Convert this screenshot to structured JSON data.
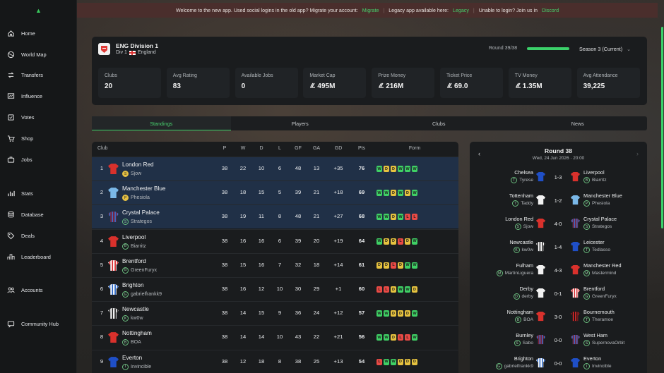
{
  "banner": {
    "text1": "Welcome to the new app. Used social logins in the old app? Migrate your account:",
    "migrate": "Migrate",
    "text2": "Legacy app available here:",
    "legacy": "Legacy",
    "text3": "Unable to login? Join us in",
    "discord": "Discord"
  },
  "sidebar": {
    "items": [
      {
        "label": "Home",
        "icon": "home-icon"
      },
      {
        "label": "World Map",
        "icon": "globe-icon"
      },
      {
        "label": "Transfers",
        "icon": "transfer-icon"
      },
      {
        "label": "Influence",
        "icon": "influence-icon"
      },
      {
        "label": "Votes",
        "icon": "votes-icon"
      },
      {
        "label": "Shop",
        "icon": "cart-icon"
      },
      {
        "label": "Jobs",
        "icon": "briefcase-icon"
      },
      {
        "label": "Stats",
        "icon": "bar-chart-icon"
      },
      {
        "label": "Database",
        "icon": "database-icon"
      },
      {
        "label": "Deals",
        "icon": "tag-icon"
      },
      {
        "label": "Leaderboard",
        "icon": "leaderboard-icon"
      },
      {
        "label": "Accounts",
        "icon": "accounts-icon"
      },
      {
        "label": "Community Hub",
        "icon": "chat-icon"
      }
    ]
  },
  "league": {
    "name": "ENG Division 1",
    "division": "Div 1",
    "country": "England",
    "round": "Round 39/38",
    "progress": 1.0,
    "season": "Season 3 (Current)"
  },
  "stats": [
    {
      "label": "Clubs",
      "value": "20"
    },
    {
      "label": "Avg Rating",
      "value": "83"
    },
    {
      "label": "Available Jobs",
      "value": "0"
    },
    {
      "label": "Market Cap",
      "value": "495M",
      "currency": true
    },
    {
      "label": "Prize Money",
      "value": "216M",
      "currency": true
    },
    {
      "label": "Ticket Price",
      "value": "69.0",
      "currency": true
    },
    {
      "label": "TV Money",
      "value": "1.35M",
      "currency": true
    },
    {
      "label": "Avg Attendance",
      "value": "39,225"
    }
  ],
  "tabs": [
    "Standings",
    "Players",
    "Clubs",
    "News"
  ],
  "standings": {
    "headers": {
      "club": "Club",
      "p": "P",
      "w": "W",
      "d": "D",
      "l": "L",
      "gf": "GF",
      "ga": "GA",
      "gd": "GD",
      "pts": "Pts",
      "form": "Form"
    },
    "rows": [
      {
        "pos": "1",
        "club": "London Red",
        "manager": "Sjow",
        "p": "38",
        "w": "22",
        "d": "10",
        "l": "6",
        "gf": "48",
        "ga": "13",
        "gd": "+35",
        "pts": "76",
        "form": [
          "W",
          "D",
          "D",
          "W",
          "W",
          "W"
        ],
        "kit": "red",
        "hl": true
      },
      {
        "pos": "2",
        "club": "Manchester Blue",
        "manager": "Phesiola",
        "p": "38",
        "w": "18",
        "d": "15",
        "l": "5",
        "gf": "39",
        "ga": "21",
        "gd": "+18",
        "pts": "69",
        "form": [
          "W",
          "W",
          "D",
          "W",
          "D",
          "W"
        ],
        "kit": "sky",
        "hl": true
      },
      {
        "pos": "3",
        "club": "Crystal Palace",
        "manager": "Strategos",
        "p": "38",
        "w": "19",
        "d": "11",
        "l": "8",
        "gf": "48",
        "ga": "21",
        "gd": "+27",
        "pts": "68",
        "form": [
          "W",
          "W",
          "D",
          "W",
          "L",
          "L"
        ],
        "kit": "claret",
        "hl": true
      },
      {
        "pos": "4",
        "club": "Liverpool",
        "manager": "Biarritz",
        "p": "38",
        "w": "16",
        "d": "16",
        "l": "6",
        "gf": "39",
        "ga": "20",
        "gd": "+19",
        "pts": "64",
        "form": [
          "W",
          "D",
          "D",
          "L",
          "D",
          "W"
        ],
        "kit": "red"
      },
      {
        "pos": "5",
        "club": "Brentford",
        "manager": "GreenFuryx",
        "p": "38",
        "w": "15",
        "d": "16",
        "l": "7",
        "gf": "32",
        "ga": "18",
        "gd": "+14",
        "pts": "61",
        "form": [
          "D",
          "D",
          "L",
          "D",
          "W",
          "W"
        ],
        "kit": "stripe"
      },
      {
        "pos": "6",
        "club": "Brighton",
        "manager": "gabrielfrankk9",
        "p": "38",
        "w": "16",
        "d": "12",
        "l": "10",
        "gf": "30",
        "ga": "29",
        "gd": "+1",
        "pts": "60",
        "form": [
          "L",
          "L",
          "D",
          "W",
          "W",
          "D"
        ],
        "kit": "bluestripe"
      },
      {
        "pos": "7",
        "club": "Newcastle",
        "manager": "kw0w",
        "p": "38",
        "w": "14",
        "d": "15",
        "l": "9",
        "gf": "36",
        "ga": "24",
        "gd": "+12",
        "pts": "57",
        "form": [
          "W",
          "W",
          "D",
          "D",
          "D",
          "W"
        ],
        "kit": "bw"
      },
      {
        "pos": "8",
        "club": "Nottingham",
        "manager": "BOA",
        "p": "38",
        "w": "14",
        "d": "14",
        "l": "10",
        "gf": "43",
        "ga": "22",
        "gd": "+21",
        "pts": "56",
        "form": [
          "W",
          "W",
          "D",
          "L",
          "L",
          "W"
        ],
        "kit": "red"
      },
      {
        "pos": "9",
        "club": "Everton",
        "manager": "Invincible",
        "p": "38",
        "w": "12",
        "d": "18",
        "l": "8",
        "gf": "38",
        "ga": "25",
        "gd": "+13",
        "pts": "54",
        "form": [
          "L",
          "W",
          "W",
          "D",
          "D",
          "D"
        ],
        "kit": "blue"
      }
    ]
  },
  "round": {
    "title": "Round 38",
    "date": "Wed, 24 Jun 2026 · 20:00",
    "matches": [
      {
        "home": "Chelsea",
        "hm": "Tyrese",
        "hk": "blue",
        "score": "1-3",
        "away": "Liverpool",
        "am": "Biarritz",
        "ak": "red"
      },
      {
        "home": "Tottenham",
        "hm": "Taddy",
        "hk": "white",
        "score": "1-2",
        "away": "Manchester Blue",
        "am": "Phesiola",
        "ak": "sky"
      },
      {
        "home": "London Red",
        "hm": "Sjow",
        "hk": "red",
        "score": "4-0",
        "away": "Crystal Palace",
        "am": "Strategos",
        "ak": "claret"
      },
      {
        "home": "Newcastle",
        "hm": "kw0w",
        "hk": "bw",
        "score": "1-4",
        "away": "Leicester",
        "am": "Tedlasso",
        "ak": "blue"
      },
      {
        "home": "Fulham",
        "hm": "MartinLiguera",
        "hk": "white",
        "score": "4-3",
        "away": "Manchester Red",
        "am": "Mastermind",
        "ak": "red"
      },
      {
        "home": "Derby",
        "hm": "derby",
        "hk": "white",
        "score": "0-1",
        "away": "Brentford",
        "am": "GreenFuryx",
        "ak": "stripe"
      },
      {
        "home": "Nottingham",
        "hm": "BOA",
        "hk": "red",
        "score": "3-0",
        "away": "Bournemouth",
        "am": "Theramoe",
        "ak": "darkstripe"
      },
      {
        "home": "Burnley",
        "hm": "Sabo",
        "hk": "claret",
        "score": "0-0",
        "away": "West Ham",
        "am": "SupernovaOrbit",
        "ak": "claret"
      },
      {
        "home": "Brighton",
        "hm": "gabrielfrankk9",
        "hk": "bluestripe",
        "score": "0-0",
        "away": "Everton",
        "am": "Invincible",
        "ak": "blue"
      }
    ]
  },
  "colors": {
    "accent": "#3bd16a",
    "highlight_row": "#203047",
    "win": "#3fd065",
    "draw": "#e6c23f",
    "loss": "#e94a45"
  }
}
